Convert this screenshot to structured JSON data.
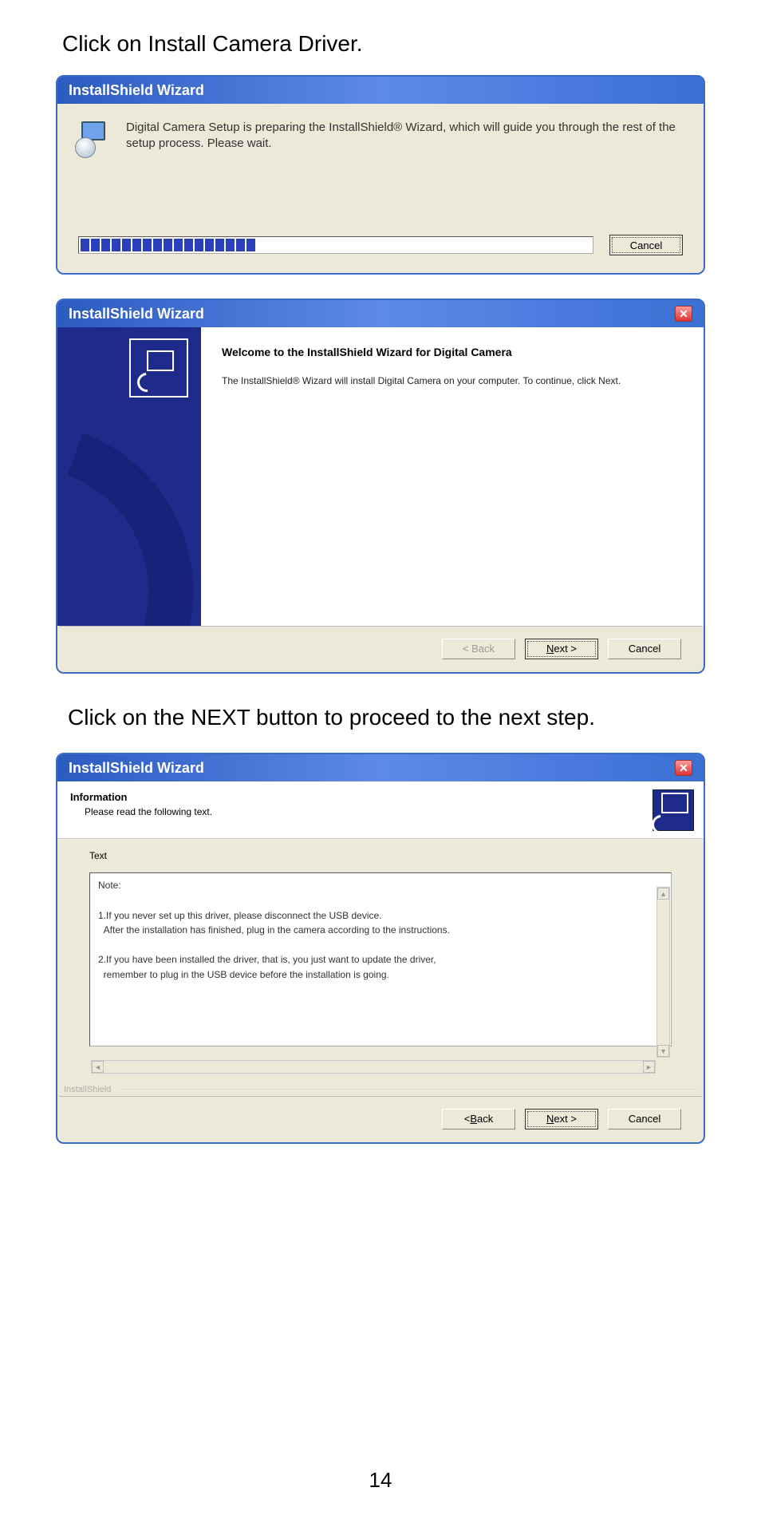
{
  "page_number": "14",
  "instruction_top": "Click on Install Camera Driver.",
  "instruction_mid": " Click on the NEXT button to proceed to the next step.",
  "dialog1": {
    "title": "InstallShield Wizard",
    "message": "Digital Camera Setup is preparing the InstallShield® Wizard, which will guide you through the rest of the setup process. Please wait.",
    "cancel_label": "Cancel",
    "progress_ticks": 17
  },
  "dialog2": {
    "title": "InstallShield Wizard",
    "heading": "Welcome to the InstallShield Wizard for Digital Camera",
    "body": "The InstallShield® Wizard will install Digital Camera on your computer.  To continue, click Next.",
    "back_label": "< Back",
    "next_prefix": "N",
    "next_suffix": "ext >",
    "cancel_label": "Cancel"
  },
  "dialog3": {
    "title": "InstallShield Wizard",
    "header_title": "Information",
    "header_sub": "Please read the following text.",
    "text_label": "Text",
    "note_text": "Note:\n\n1.If you never set up this driver, please disconnect the USB device.\n  After the installation has finished, plug in the camera according to the instructions.\n\n2.If you have been installed the driver, that is, you just want to update the driver,\n  remember to plug in the USB device before the installation is going.",
    "footer_brand": "InstallShield",
    "back_prefix": "< ",
    "back_ul": "B",
    "back_suffix": "ack",
    "next_prefix": "N",
    "next_suffix": "ext >",
    "cancel_label": "Cancel"
  }
}
